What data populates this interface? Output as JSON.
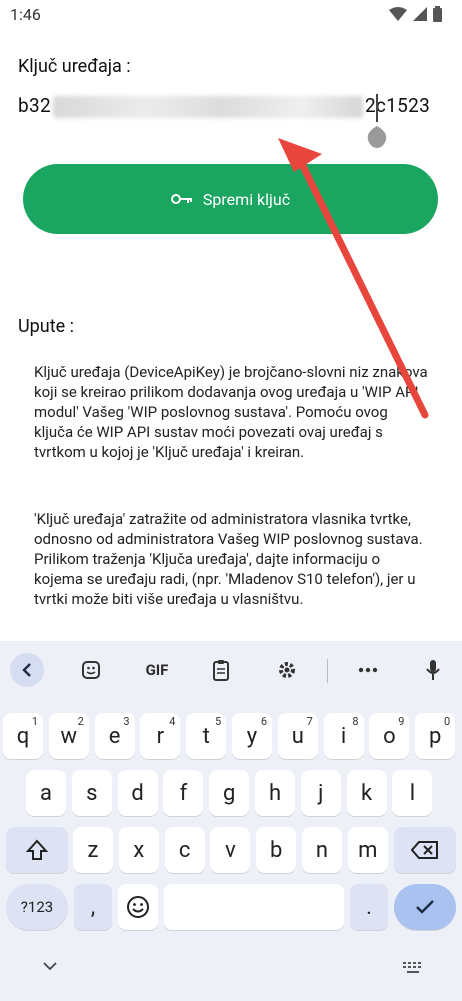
{
  "status_bar": {
    "time": "1:46",
    "icons": [
      "wifi-icon",
      "signal-icon",
      "battery-icon"
    ]
  },
  "key_field": {
    "label": "Ključ uređaja :",
    "value_prefix": "b32",
    "value_suffix": "2c1523"
  },
  "save_button": {
    "label": "Spremi ključ",
    "icon": "key-icon",
    "color": "#1aa561"
  },
  "instructions": {
    "title": "Upute :",
    "paragraph1": "Ključ uređaja (DeviceApiKey) je brojčano-slovni niz znakova koji se kreirao prilikom dodavanja ovog uređaja u 'WIP API modul' Vašeg 'WIP poslovnog sustava'. Pomoću ovog ključa će WIP API sustav moći povezati ovaj uređaj s tvrtkom u kojoj je 'Ključ uređaja' i kreiran.",
    "paragraph2": "'Ključ uređaja' zatražite od administratora vlasnika tvrtke, odnosno od administratora Vašeg WIP poslovnog sustava. Prilikom traženja 'Ključa uređaja', dajte informaciju o kojema se uređaju radi, (npr. 'Mladenov S10 telefon'), jer u tvrtki može biti više uređaja u vlasništvu."
  },
  "annotation": {
    "arrow_color": "#e8453c"
  },
  "keyboard": {
    "toolbar": [
      "back-icon",
      "sticker-icon",
      "GIF",
      "clipboard-icon",
      "settings-icon",
      "more-icon",
      "mic-icon"
    ],
    "gif_label": "GIF",
    "row1": [
      {
        "k": "q",
        "h": "1"
      },
      {
        "k": "w",
        "h": "2"
      },
      {
        "k": "e",
        "h": "3"
      },
      {
        "k": "r",
        "h": "4"
      },
      {
        "k": "t",
        "h": "5"
      },
      {
        "k": "y",
        "h": "6"
      },
      {
        "k": "u",
        "h": "7"
      },
      {
        "k": "i",
        "h": "8"
      },
      {
        "k": "o",
        "h": "9"
      },
      {
        "k": "p",
        "h": "0"
      }
    ],
    "row2": [
      "a",
      "s",
      "d",
      "f",
      "g",
      "h",
      "j",
      "k",
      "l"
    ],
    "row3": [
      "z",
      "x",
      "c",
      "v",
      "b",
      "n",
      "m"
    ],
    "symbols_label": "?123",
    "comma_label": ",",
    "period_label": ".",
    "emoji_icon": "emoji-icon",
    "shift_icon": "shift-icon",
    "backspace_icon": "backspace-icon",
    "enter_icon": "checkmark-icon",
    "nav": [
      "chevron-down-icon",
      "keyboard-switch-icon"
    ]
  }
}
